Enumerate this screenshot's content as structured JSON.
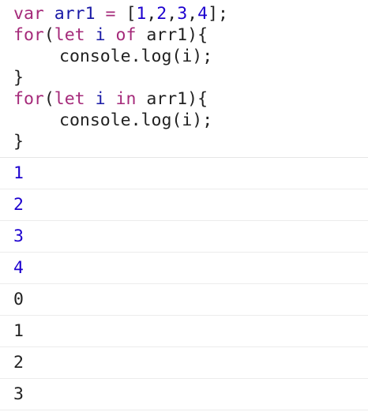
{
  "code": {
    "line1": {
      "kw_var": "var",
      "name": "arr1",
      "eq": "=",
      "open": "[",
      "n1": "1",
      "c1": ",",
      "n2": "2",
      "c2": ",",
      "n3": "3",
      "c3": ",",
      "n4": "4",
      "close": "];"
    },
    "line2": {
      "kw_for": "for",
      "paren_open": "(",
      "kw_let": "let",
      "var_i": "i",
      "kw_of": "of",
      "target": "arr1",
      "paren_close": "){"
    },
    "line3": {
      "text": "console.log(i);"
    },
    "line4": {
      "text": "}"
    },
    "line5": {
      "kw_for": "for",
      "paren_open": "(",
      "kw_let": "let",
      "var_i": "i",
      "kw_in": "in",
      "target": "arr1",
      "paren_close": "){"
    },
    "line6": {
      "text": "console.log(i);"
    },
    "line7": {
      "text": "}"
    }
  },
  "output": {
    "rows": [
      {
        "value": "1",
        "kind": "number"
      },
      {
        "value": "2",
        "kind": "number"
      },
      {
        "value": "3",
        "kind": "number"
      },
      {
        "value": "4",
        "kind": "number"
      },
      {
        "value": "0",
        "kind": "string"
      },
      {
        "value": "1",
        "kind": "string"
      },
      {
        "value": "2",
        "kind": "string"
      },
      {
        "value": "3",
        "kind": "string"
      }
    ]
  },
  "colors": {
    "keyword": "#a52a7a",
    "identifier": "#1a1aa6",
    "number": "#1c00cf",
    "text": "#222222",
    "divider": "#e6e6e6"
  }
}
